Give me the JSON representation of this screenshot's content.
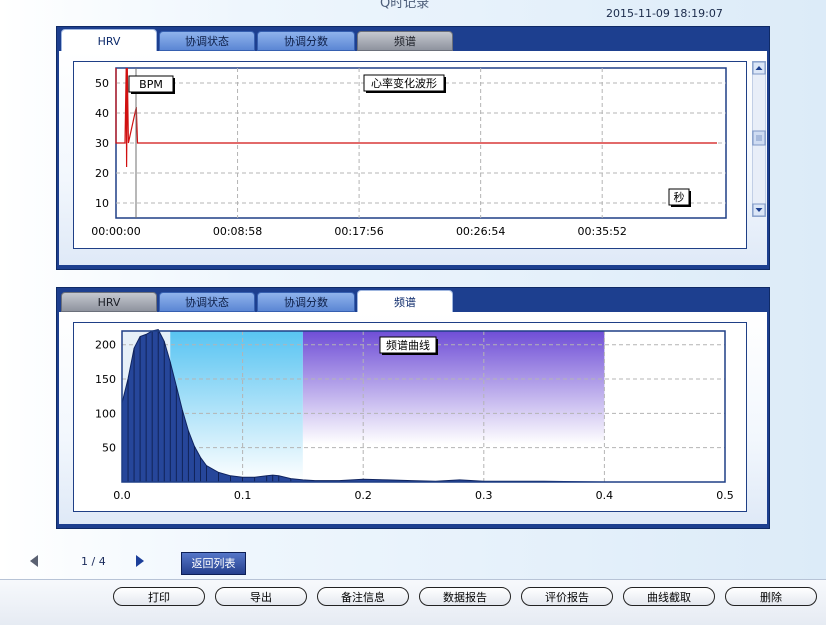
{
  "page": {
    "title": "Q时记录",
    "timestamp": "2015-11-09 18:19:07"
  },
  "panel_top": {
    "tabs": [
      {
        "label": "HRV",
        "state": "active"
      },
      {
        "label": "协调状态",
        "state": "blue"
      },
      {
        "label": "协调分数",
        "state": "blue"
      },
      {
        "label": "频谱",
        "state": "gray"
      }
    ]
  },
  "panel_bottom": {
    "tabs": [
      {
        "label": "HRV",
        "state": "gray"
      },
      {
        "label": "协调状态",
        "state": "blue"
      },
      {
        "label": "协调分数",
        "state": "blue"
      },
      {
        "label": "频谱",
        "state": "active"
      }
    ]
  },
  "chart_data": [
    {
      "type": "line",
      "title": "心率变化波形",
      "ylabel": "BPM",
      "xlabel": "秒",
      "x_tick_labels": [
        "00:00:00",
        "00:08:58",
        "00:17:56",
        "00:26:54",
        "00:35:52"
      ],
      "y_ticks": [
        10,
        20,
        30,
        40,
        50
      ],
      "ylim": [
        5,
        55
      ],
      "grid": true,
      "series": [
        {
          "color": "#d01010",
          "points": [
            [
              0,
              55
            ],
            [
              0,
              30
            ],
            [
              40,
              30
            ],
            [
              45,
              55
            ],
            [
              47,
              22
            ],
            [
              50,
              55
            ],
            [
              55,
              30
            ],
            [
              90,
              42
            ],
            [
              95,
              30
            ],
            [
              2660,
              30
            ]
          ]
        }
      ]
    },
    {
      "type": "area",
      "title": "频谱曲线",
      "x_tick_labels": [
        "0.0",
        "0.1",
        "0.2",
        "0.3",
        "0.4",
        "0.5"
      ],
      "y_ticks": [
        50,
        100,
        150,
        200
      ],
      "xlim": [
        0,
        0.5
      ],
      "ylim": [
        0,
        220
      ],
      "grid": true,
      "bands": [
        {
          "from": 0.0,
          "to": 0.04,
          "color": "#e6f0f8"
        },
        {
          "from": 0.04,
          "to": 0.15,
          "color": "#58c4f2"
        },
        {
          "from": 0.15,
          "to": 0.4,
          "color": "#6f4ed6"
        }
      ],
      "series": [
        {
          "color": "#26469a",
          "x": [
            0.0,
            0.005,
            0.01,
            0.015,
            0.02,
            0.025,
            0.03,
            0.035,
            0.04,
            0.045,
            0.05,
            0.055,
            0.06,
            0.065,
            0.07,
            0.08,
            0.09,
            0.1,
            0.11,
            0.12,
            0.125,
            0.13,
            0.14,
            0.15,
            0.16,
            0.18,
            0.2,
            0.22,
            0.24,
            0.26,
            0.28,
            0.3,
            0.35,
            0.4,
            0.45,
            0.5
          ],
          "values": [
            115,
            150,
            195,
            212,
            215,
            220,
            222,
            205,
            175,
            140,
            105,
            75,
            52,
            36,
            24,
            14,
            9,
            7,
            7,
            9,
            10,
            9,
            5,
            3,
            2,
            2,
            4,
            3,
            2,
            1,
            3,
            1,
            1,
            0,
            0,
            0
          ]
        }
      ]
    }
  ],
  "pager": {
    "text": "1 / 4",
    "back_label": "返回列表"
  },
  "buttons": [
    "打印",
    "导出",
    "备注信息",
    "数据报告",
    "评价报告",
    "曲线截取",
    "删除"
  ]
}
